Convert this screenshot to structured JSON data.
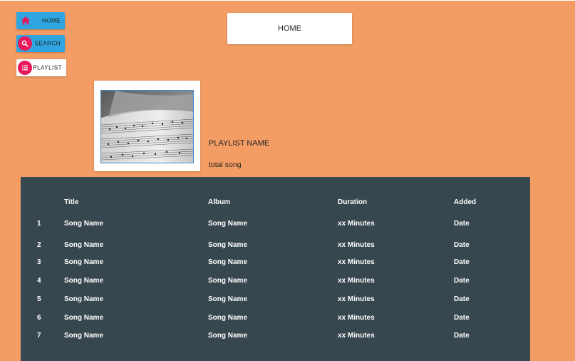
{
  "sidebar": {
    "items": [
      {
        "label": "HOME",
        "icon": "home-icon"
      },
      {
        "label": "SEARCH",
        "icon": "search-icon"
      },
      {
        "label": "PLAYLIST",
        "icon": "list-icon"
      }
    ]
  },
  "header": {
    "title": "HOME"
  },
  "playlist": {
    "name": "PLAYLIST NAME",
    "total": "total song",
    "cover": "sheet-music-image"
  },
  "table": {
    "columns": [
      "Title",
      "Album",
      "Duration",
      "Added"
    ],
    "rows": [
      {
        "num": "1",
        "title": "Song Name",
        "album": "Song Name",
        "duration": "xx Minutes",
        "added": "Date"
      },
      {
        "num": "2",
        "title": "Song Name",
        "album": "Song Name",
        "duration": "xx Minutes",
        "added": "Date"
      },
      {
        "num": "3",
        "title": "Song Name",
        "album": "Song Name",
        "duration": "xx Minutes",
        "added": "Date"
      },
      {
        "num": "4",
        "title": "Song Name",
        "album": "Song Name",
        "duration": "xx Minutes",
        "added": "Date"
      },
      {
        "num": "5",
        "title": "Song Name",
        "album": "Song Name",
        "duration": "xx Minutes",
        "added": "Date"
      },
      {
        "num": "6",
        "title": "Song Name",
        "album": "Song Name",
        "duration": "xx Minutes",
        "added": "Date"
      },
      {
        "num": "7",
        "title": "Song Name",
        "album": "Song Name",
        "duration": "xx Minutes",
        "added": "Date"
      }
    ]
  },
  "colors": {
    "background": "#f39c63",
    "accent_blue": "#2fa6e0",
    "accent_pink": "#e8185a",
    "table_bg": "#37474f"
  }
}
